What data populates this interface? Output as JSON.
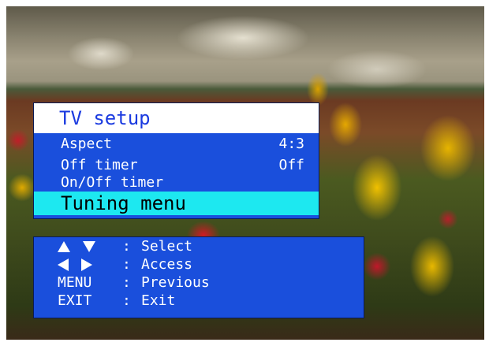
{
  "menu": {
    "title": "TV setup",
    "items": [
      {
        "label": "Aspect",
        "value": "4:3"
      },
      {
        "label": "Off timer",
        "value": "Off"
      },
      {
        "label": "On/Off timer",
        "value": ""
      },
      {
        "label": "Tuning menu",
        "value": "",
        "selected": true
      }
    ]
  },
  "help": {
    "rows": [
      {
        "keys": [
          "up-arrow-icon",
          "down-arrow-icon"
        ],
        "key_text": "",
        "separator": ":",
        "description": "Select"
      },
      {
        "keys": [
          "left-arrow-icon",
          "right-arrow-icon"
        ],
        "key_text": "",
        "separator": ":",
        "description": "Access"
      },
      {
        "keys": [],
        "key_text": "MENU",
        "separator": ":",
        "description": "Previous"
      },
      {
        "keys": [],
        "key_text": "EXIT",
        "separator": ":",
        "description": "Exit"
      }
    ]
  },
  "colors": {
    "panel": "#1a4fdc",
    "highlight": "#1de8f0",
    "title_text": "#1a3ae0"
  }
}
